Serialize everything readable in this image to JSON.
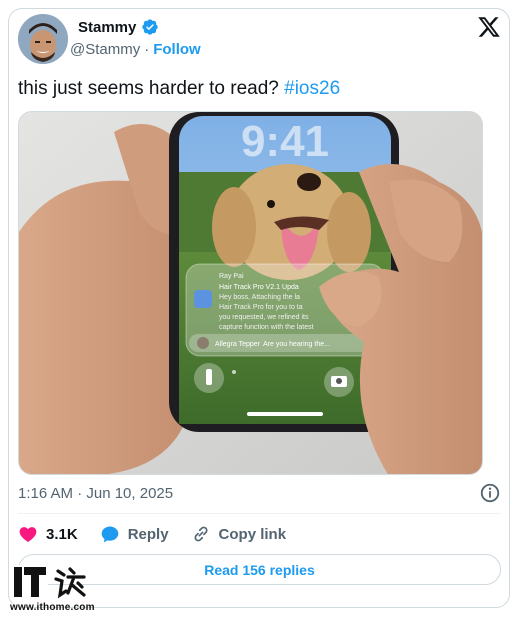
{
  "author": {
    "display_name": "Stammy",
    "handle": "@Stammy",
    "separator": "·",
    "follow_label": "Follow",
    "verified": true
  },
  "tweet": {
    "text_plain": "this just seems harder to read?",
    "hashtag": "#ios26"
  },
  "media": {
    "description_icon": "photo",
    "phone_notification": {
      "sender": "Ray Pai",
      "title": "Hair Track Pro V2.1 Upda",
      "line1": "Hey boss, Attaching the la",
      "line2": "Hair Track Pro for you to ta",
      "line3": "you requested, we refined its",
      "line4": "capture function with the latest",
      "reply_name": "Allegra Tepper",
      "reply_text": "Are you hearing the..."
    },
    "clock": "9:41"
  },
  "meta": {
    "timestamp": "1:16 AM · Jun 10, 2025"
  },
  "actions": {
    "likes": "3.1K",
    "reply_label": "Reply",
    "copy_link_label": "Copy link"
  },
  "replies_button": "Read 156 replies",
  "watermark": {
    "logo": "IT之家",
    "url": "www.ithome.com"
  },
  "colors": {
    "accent": "#1d9bf0",
    "like": "#f91880",
    "text": "#0f1419",
    "muted": "#536471"
  }
}
